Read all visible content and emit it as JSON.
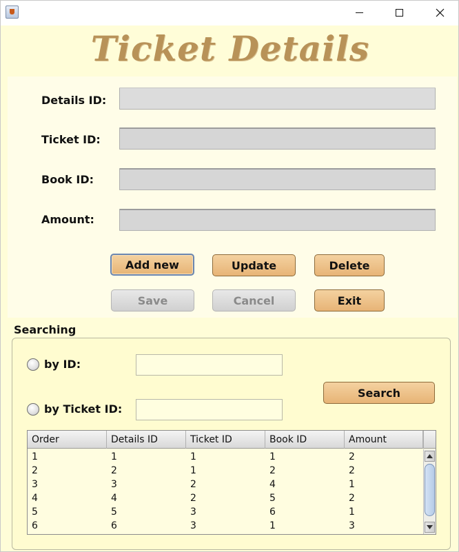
{
  "window": {
    "title": "",
    "minimize_icon": "minimize-icon",
    "maximize_icon": "maximize-icon",
    "close_icon": "close-icon"
  },
  "heading": "Ticket Details",
  "form": {
    "details_id_label": "Details ID:",
    "details_id_value": "",
    "ticket_id_label": "Ticket ID:",
    "ticket_id_value": "",
    "book_id_label": "Book ID:",
    "book_id_value": "",
    "amount_label": "Amount:",
    "amount_value": ""
  },
  "buttons": {
    "add_new": "Add new",
    "update": "Update",
    "delete": "Delete",
    "save": "Save",
    "cancel": "Cancel",
    "exit": "Exit"
  },
  "search": {
    "title": "Searching",
    "by_id_label": "by ID:",
    "by_id_value": "",
    "by_ticket_id_label": "by Ticket ID:",
    "by_ticket_id_value": "",
    "search_button": "Search"
  },
  "table": {
    "columns": [
      "Order",
      "Details ID",
      "Ticket ID",
      "Book ID",
      "Amount"
    ],
    "rows": [
      [
        "1",
        "1",
        "1",
        "1",
        "2"
      ],
      [
        "2",
        "2",
        "1",
        "2",
        "2"
      ],
      [
        "3",
        "3",
        "2",
        "4",
        "1"
      ],
      [
        "4",
        "4",
        "2",
        "5",
        "2"
      ],
      [
        "5",
        "5",
        "3",
        "6",
        "1"
      ],
      [
        "6",
        "6",
        "3",
        "1",
        "3"
      ]
    ]
  },
  "colors": {
    "background": "#fffdd8",
    "heading": "#b89258",
    "button_orange": "#e7b476"
  }
}
